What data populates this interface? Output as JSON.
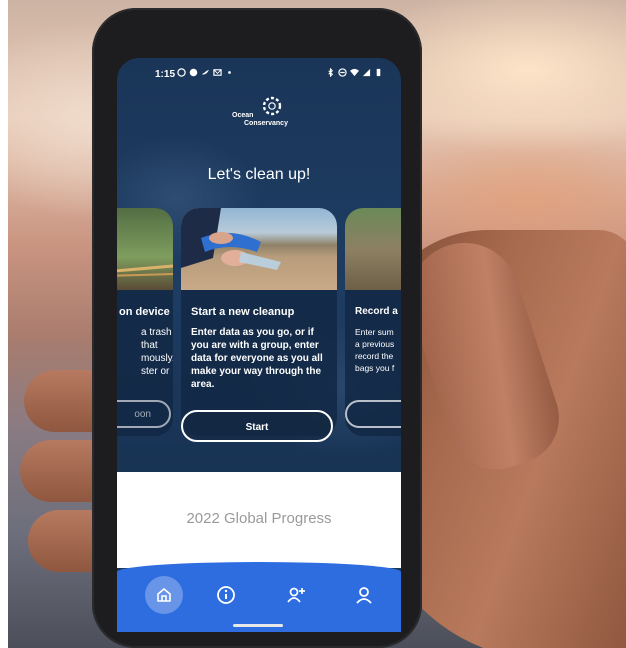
{
  "status_bar": {
    "time": "1:15",
    "left_icons": [
      "whatsapp-icon",
      "messenger-icon",
      "twitter-icon",
      "gmail-icon",
      "dot-icon"
    ],
    "right_icons": [
      "bluetooth-icon",
      "do-not-disturb-icon",
      "wifi-icon",
      "signal-icon",
      "battery-icon"
    ]
  },
  "logo": {
    "line1": "Ocean",
    "line2": "Conservancy"
  },
  "heading": "Let's clean up!",
  "cards": {
    "left": {
      "title_fragment": "on device",
      "desc_lines": [
        "a trash",
        "that",
        "mously.",
        "ster or"
      ],
      "button_fragment": "oon"
    },
    "main": {
      "title": "Start a new cleanup",
      "description": "Enter data as you go, or if you are with a group, enter data for everyone as you all make your way through the area.",
      "button_label": "Start"
    },
    "right": {
      "title_fragment": "Record a",
      "desc_lines": [
        "Enter sum",
        "a previous",
        "record the",
        "bags you f"
      ]
    }
  },
  "progress": {
    "title": "2022 Global Progress"
  },
  "nav": {
    "items": [
      "home-icon",
      "info-icon",
      "add-user-icon",
      "profile-icon"
    ],
    "accent": "#2e6de0"
  }
}
